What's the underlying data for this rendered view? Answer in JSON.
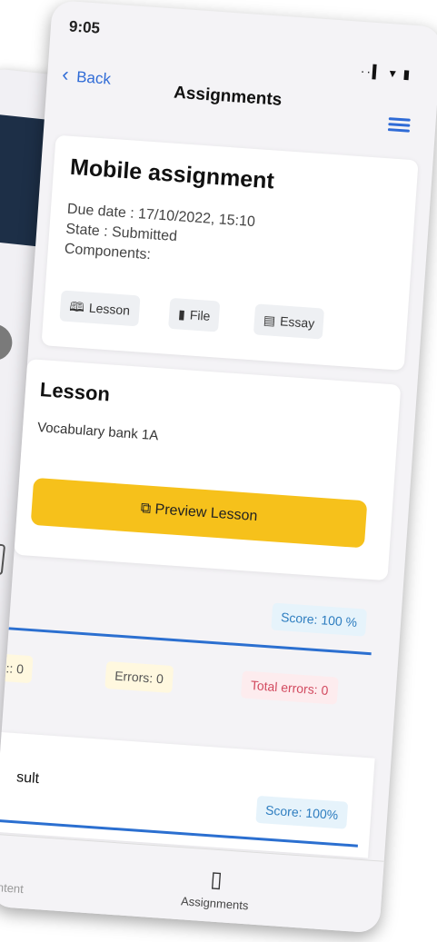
{
  "status": {
    "time": "9:05",
    "icons": "··▍ ▾ ▮"
  },
  "nav": {
    "back_label": "Back",
    "title": "Assignments"
  },
  "assignment": {
    "title": "Mobile assignment",
    "due": "Due date : 17/10/2022, 15:10",
    "state": "State : Submitted",
    "components_label": "Components:",
    "components": [
      {
        "icon": "book-icon",
        "glyph": "🕮",
        "label": "Lesson"
      },
      {
        "icon": "file-icon",
        "glyph": "▮",
        "label": "File"
      },
      {
        "icon": "essay-icon",
        "glyph": "▤",
        "label": "Essay"
      }
    ]
  },
  "lesson": {
    "title": "Lesson",
    "name": "Vocabulary bank 1A",
    "preview_label": "Preview Lesson"
  },
  "results": {
    "score": "Score: 100 %",
    "stats": [
      ":: 0",
      "Errors: 0",
      "Total errors: 0"
    ]
  },
  "final": {
    "label": "sult",
    "score": "Score: 100%"
  },
  "tabbar": {
    "left": "ontent",
    "right": "Assignments"
  },
  "colors": {
    "accent": "#2f6bd6",
    "button": "#f6c11b",
    "score_text": "#2f7ec0",
    "error_text": "#d24a5f"
  }
}
